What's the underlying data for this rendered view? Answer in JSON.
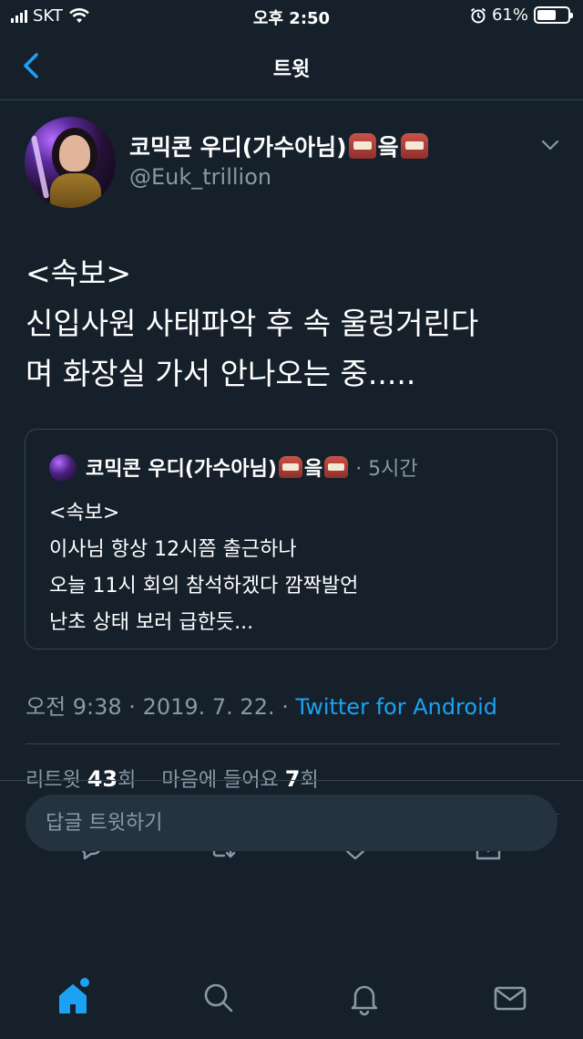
{
  "status_bar": {
    "carrier": "SKT",
    "time": "오후 2:50",
    "battery_percent": "61%",
    "battery_level": 0.61
  },
  "nav": {
    "title": "트윗"
  },
  "tweet": {
    "display_name": "코믹콘 우디(가수아님)",
    "display_name_suffix": "읔",
    "handle": "@Euk_trillion",
    "text_lines": [
      "<속보>",
      "신입사원 사태파악 후 속 울렁거린다",
      "며 화장실 가서 안나오는 중....."
    ],
    "quoted": {
      "display_name": "코믹콘 우디(가수아님)",
      "display_name_suffix": "읔",
      "time": "· 5시간",
      "text_lines": [
        "<속보>",
        "이사님 항상 12시쯤 출근하나",
        "오늘 11시 회의 참석하겠다 깜짝발언",
        "난초 상태 보러 급한듯..."
      ]
    },
    "timestamp": "오전 9:38 · 2019. 7. 22. · ",
    "client": "Twitter for Android",
    "retweet_label": "리트윗 ",
    "retweet_count": "43",
    "retweet_unit": "회",
    "like_label": "마음에 들어요 ",
    "like_count": "7",
    "like_unit": "회"
  },
  "reply": {
    "placeholder": "답글 트윗하기"
  },
  "icons": {
    "back": "chevron-left-icon",
    "caret": "chevron-down-icon",
    "reply": "reply-icon",
    "retweet": "retweet-icon",
    "like": "heart-icon",
    "share": "share-icon",
    "home": "home-icon",
    "search": "search-icon",
    "notifications": "bell-icon",
    "messages": "mail-icon"
  },
  "colors": {
    "background": "#15202b",
    "accent": "#1da1f2",
    "secondary_text": "#8899a6",
    "border": "#38444d"
  }
}
